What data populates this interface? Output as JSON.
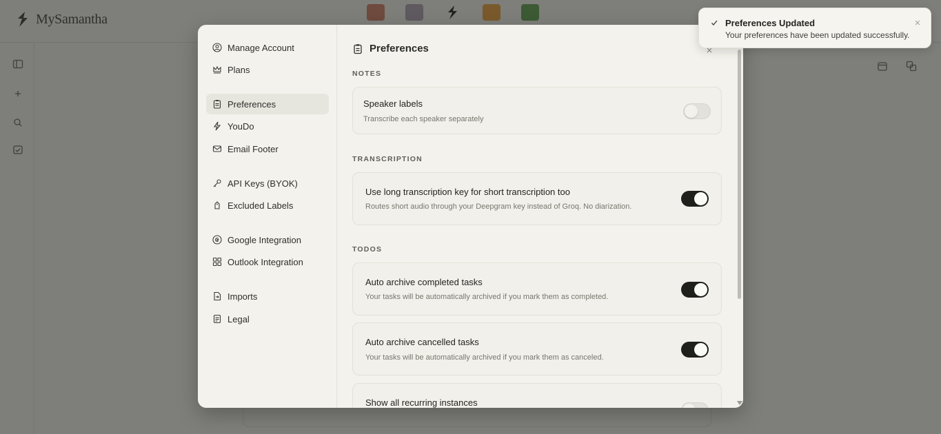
{
  "app": {
    "name": "MySamantha"
  },
  "nav": {
    "items": [
      {
        "label": "Manage Account",
        "icon": "user-circle-icon"
      },
      {
        "label": "Plans",
        "icon": "crown-icon"
      },
      {
        "label": "Preferences",
        "icon": "clipboard-icon",
        "active": true
      },
      {
        "label": "YouDo",
        "icon": "bolt-icon"
      },
      {
        "label": "Email Footer",
        "icon": "mail-icon"
      },
      {
        "label": "API Keys (BYOK)",
        "icon": "key-icon"
      },
      {
        "label": "Excluded Labels",
        "icon": "tag-icon"
      },
      {
        "label": "Google Integration",
        "icon": "google-icon"
      },
      {
        "label": "Outlook Integration",
        "icon": "grid-icon"
      },
      {
        "label": "Imports",
        "icon": "file-import-icon"
      },
      {
        "label": "Legal",
        "icon": "document-icon"
      }
    ]
  },
  "main": {
    "title": "Preferences",
    "sections": {
      "notes": "NOTES",
      "transcription": "TRANSCRIPTION",
      "todos": "TODOS"
    },
    "settings": {
      "speaker_labels": {
        "title": "Speaker labels",
        "desc": "Transcribe each speaker separately",
        "enabled": false
      },
      "long_transcription": {
        "title": "Use long transcription key for short transcription too",
        "desc": "Routes short audio through your Deepgram key instead of Groq. No diarization.",
        "enabled": true
      },
      "auto_archive_completed": {
        "title": "Auto archive completed tasks",
        "desc": "Your tasks will be automatically archived if you mark them as completed.",
        "enabled": true
      },
      "auto_archive_cancelled": {
        "title": "Auto archive cancelled tasks",
        "desc": "Your tasks will be automatically archived if you mark them as canceled.",
        "enabled": true
      },
      "show_recurring": {
        "title": "Show all recurring instances",
        "enabled": false
      }
    }
  },
  "toast": {
    "title": "Preferences Updated",
    "message": "Your preferences have been updated successfully."
  },
  "colors": {
    "toggle_on": "#1f1f1c",
    "modal_bg": "#f3f2ec",
    "overlay": "#7e7e7a"
  }
}
